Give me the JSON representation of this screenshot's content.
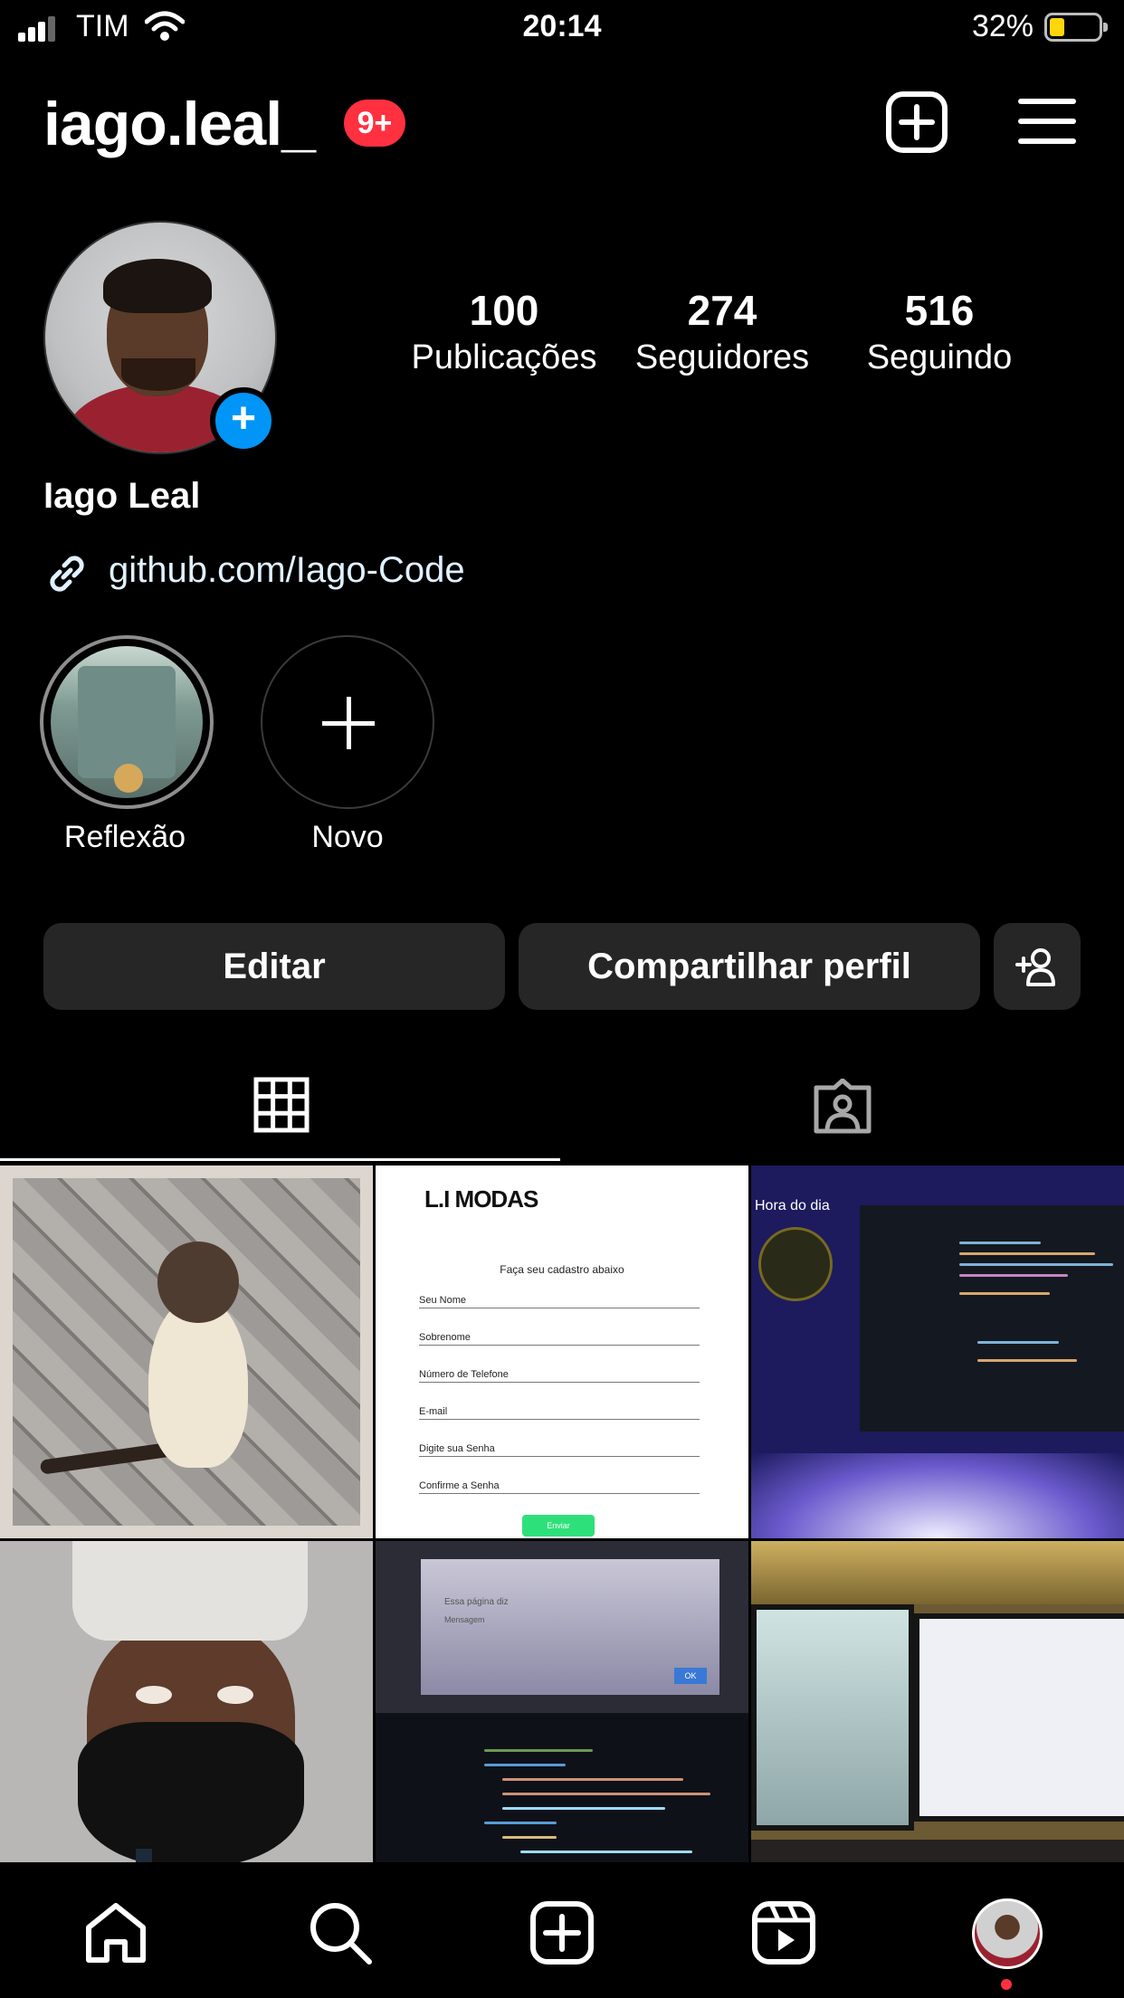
{
  "status_bar": {
    "carrier": "TIM",
    "time": "20:14",
    "battery": "32%"
  },
  "header": {
    "username": "iago.leal_",
    "notification_badge": "9+"
  },
  "profile": {
    "stats": [
      {
        "value": "100",
        "label": "Publicações"
      },
      {
        "value": "274",
        "label": "Seguidores"
      },
      {
        "value": "516",
        "label": "Seguindo"
      }
    ],
    "full_name": "Iago Leal",
    "link": "github.com/Iago-Code"
  },
  "highlights": [
    {
      "label": "Reflexão"
    },
    {
      "label": "Novo"
    }
  ],
  "actions": {
    "edit": "Editar",
    "share": "Compartilhar perfil"
  },
  "posts": {
    "form": {
      "logo": "L.I MODAS",
      "title": "Faça seu cadastro abaixo",
      "fields": [
        "Seu Nome",
        "Sobrenome",
        "Número de Telefone",
        "E-mail",
        "Digite sua Senha",
        "Confirme a Senha"
      ],
      "button": "Enviar"
    },
    "clock_app": {
      "title": "Hora do dia"
    },
    "alert": {
      "title": "Essa página diz",
      "message": "Mensagem",
      "ok": "OK"
    }
  },
  "colors": {
    "accent_blue": "#0095f6",
    "badge_red": "#ff3040",
    "button_bg": "#262626"
  },
  "icons": [
    "add-post-icon",
    "menu-icon",
    "link-icon",
    "add-person-icon",
    "grid-icon",
    "tagged-icon",
    "home-icon",
    "search-icon",
    "create-icon",
    "reels-icon"
  ]
}
